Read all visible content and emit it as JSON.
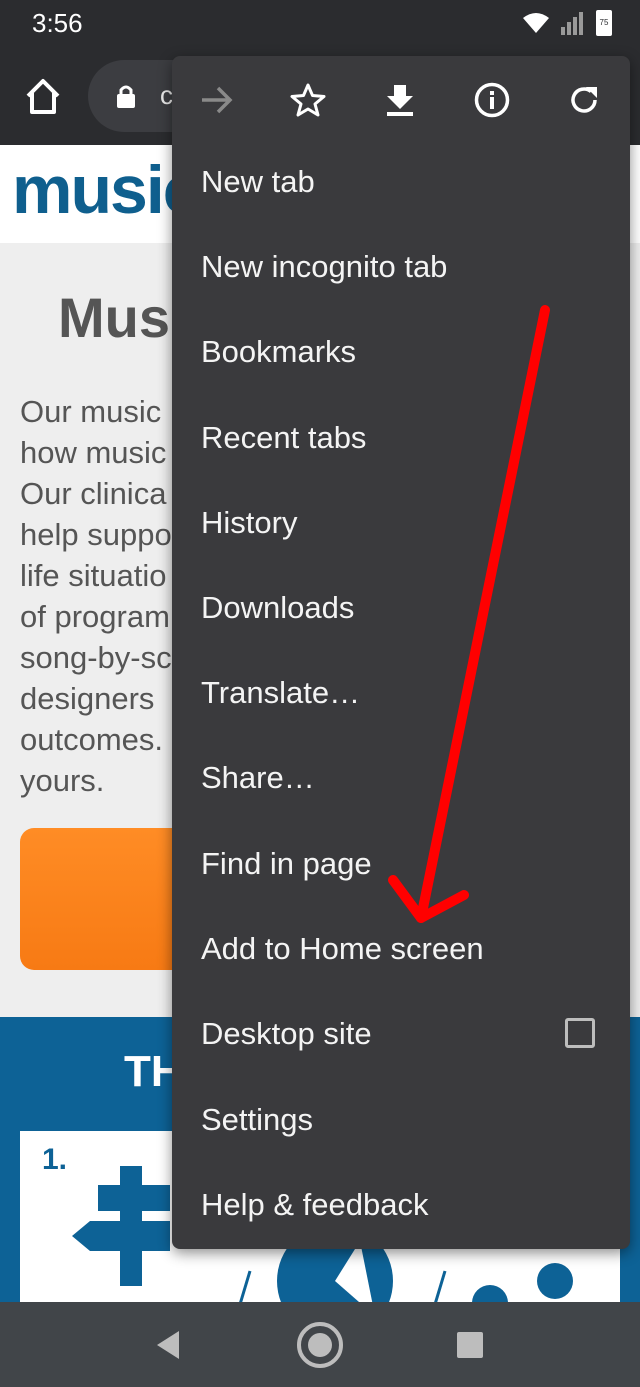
{
  "status_bar": {
    "time": "3:56",
    "battery_level": "75",
    "icons": [
      "wifi-icon",
      "signal-icon",
      "battery-icon"
    ]
  },
  "toolbar": {
    "url_text": "c",
    "icons": [
      "home-icon",
      "lock-icon"
    ]
  },
  "page": {
    "logo_text": "music",
    "heading": "Mus",
    "paragraph": "Our music\nhow music\nOur clinica\nhelp suppo\nlife situatio\nof program\nsong-by-sc\ndesigners \noutcomes.\nyours.",
    "band_title": "TH",
    "card_number": "1."
  },
  "menu": {
    "top_icons": [
      "forward-icon",
      "bookmark-star-icon",
      "download-icon",
      "info-icon",
      "reload-icon"
    ],
    "items": [
      {
        "label": "New tab"
      },
      {
        "label": "New incognito tab"
      },
      {
        "label": "Bookmarks"
      },
      {
        "label": "Recent tabs"
      },
      {
        "label": "History"
      },
      {
        "label": "Downloads"
      },
      {
        "label": "Translate…"
      },
      {
        "label": "Share…"
      },
      {
        "label": "Find in page"
      },
      {
        "label": "Add to Home screen"
      },
      {
        "label": "Desktop site",
        "checkbox_checked": false
      },
      {
        "label": "Settings"
      },
      {
        "label": "Help & feedback"
      }
    ]
  },
  "annotation": {
    "color": "#ff0000",
    "points_to": "Add to Home screen"
  },
  "nav_bar": {
    "icons": [
      "back-icon",
      "home-circle-icon",
      "recents-icon"
    ]
  },
  "colors": {
    "toolbar_bg": "#2b2c2f",
    "menu_bg": "#3a3a3d",
    "brand_blue": "#0d6296",
    "cta_orange": "#f77a14"
  }
}
